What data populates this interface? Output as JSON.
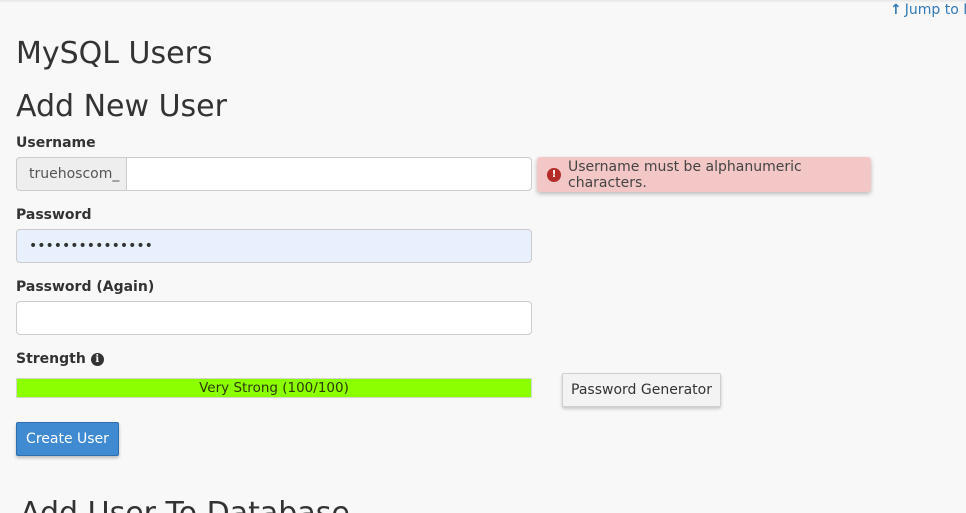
{
  "header": {
    "jump_link": "Jump to M",
    "jump_arrow": "↑"
  },
  "page": {
    "title": "MySQL Users",
    "section_title": "Add New User",
    "next_section_title": "Add User To Database"
  },
  "form": {
    "username": {
      "label": "Username",
      "prefix": "truehoscom_",
      "value": "",
      "error": "Username must be alphanumeric characters."
    },
    "password": {
      "label": "Password",
      "value": "•••••••••••••••"
    },
    "password_again": {
      "label": "Password (Again)",
      "value": ""
    },
    "strength": {
      "label": "Strength",
      "text": "Very Strong (100/100)",
      "score": 100,
      "bar_color": "#8cff00"
    },
    "generator_button": "Password Generator",
    "create_button": "Create User"
  },
  "icons": {
    "error": "exclamation-circle-icon",
    "info": "info-circle-icon",
    "arrow": "arrow-up-icon"
  },
  "colors": {
    "link": "#337ab7",
    "primary": "#3f8ad1",
    "error_bg": "#f2c7c6",
    "error_icon": "#b52b27"
  }
}
